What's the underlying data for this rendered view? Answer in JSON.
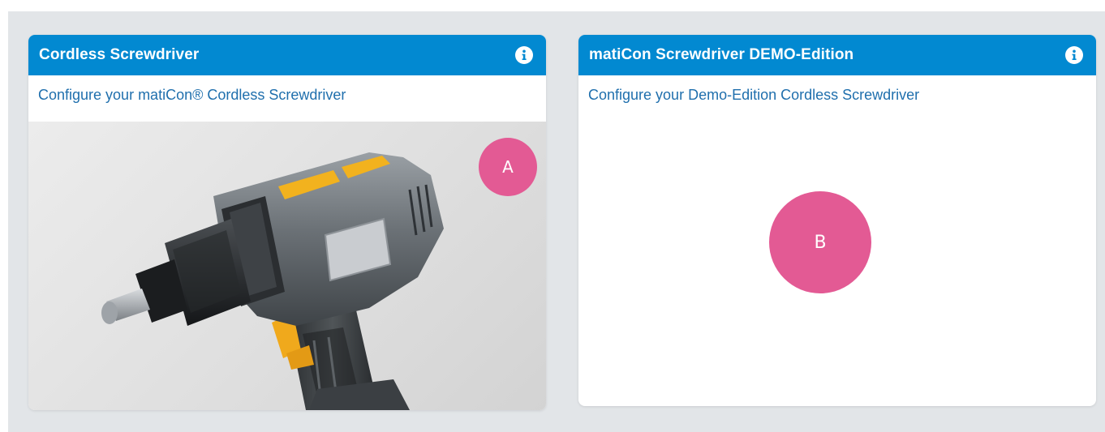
{
  "cards": [
    {
      "title": "Cordless Screwdriver",
      "subtitle": "Configure your matiCon® Cordless Screwdriver",
      "image": "cordless-screwdriver-drill",
      "badge": "A",
      "icon": "info-icon"
    },
    {
      "title": "matiCon Screwdriver DEMO-Edition",
      "subtitle": "Configure your Demo-Edition Cordless Screwdriver",
      "badge": "B",
      "icon": "info-icon"
    }
  ],
  "colors": {
    "header": "#0289d1",
    "subtitle_text": "#1f6fad",
    "badge": "#e35a94",
    "panel_background": "#e2e5e8"
  }
}
